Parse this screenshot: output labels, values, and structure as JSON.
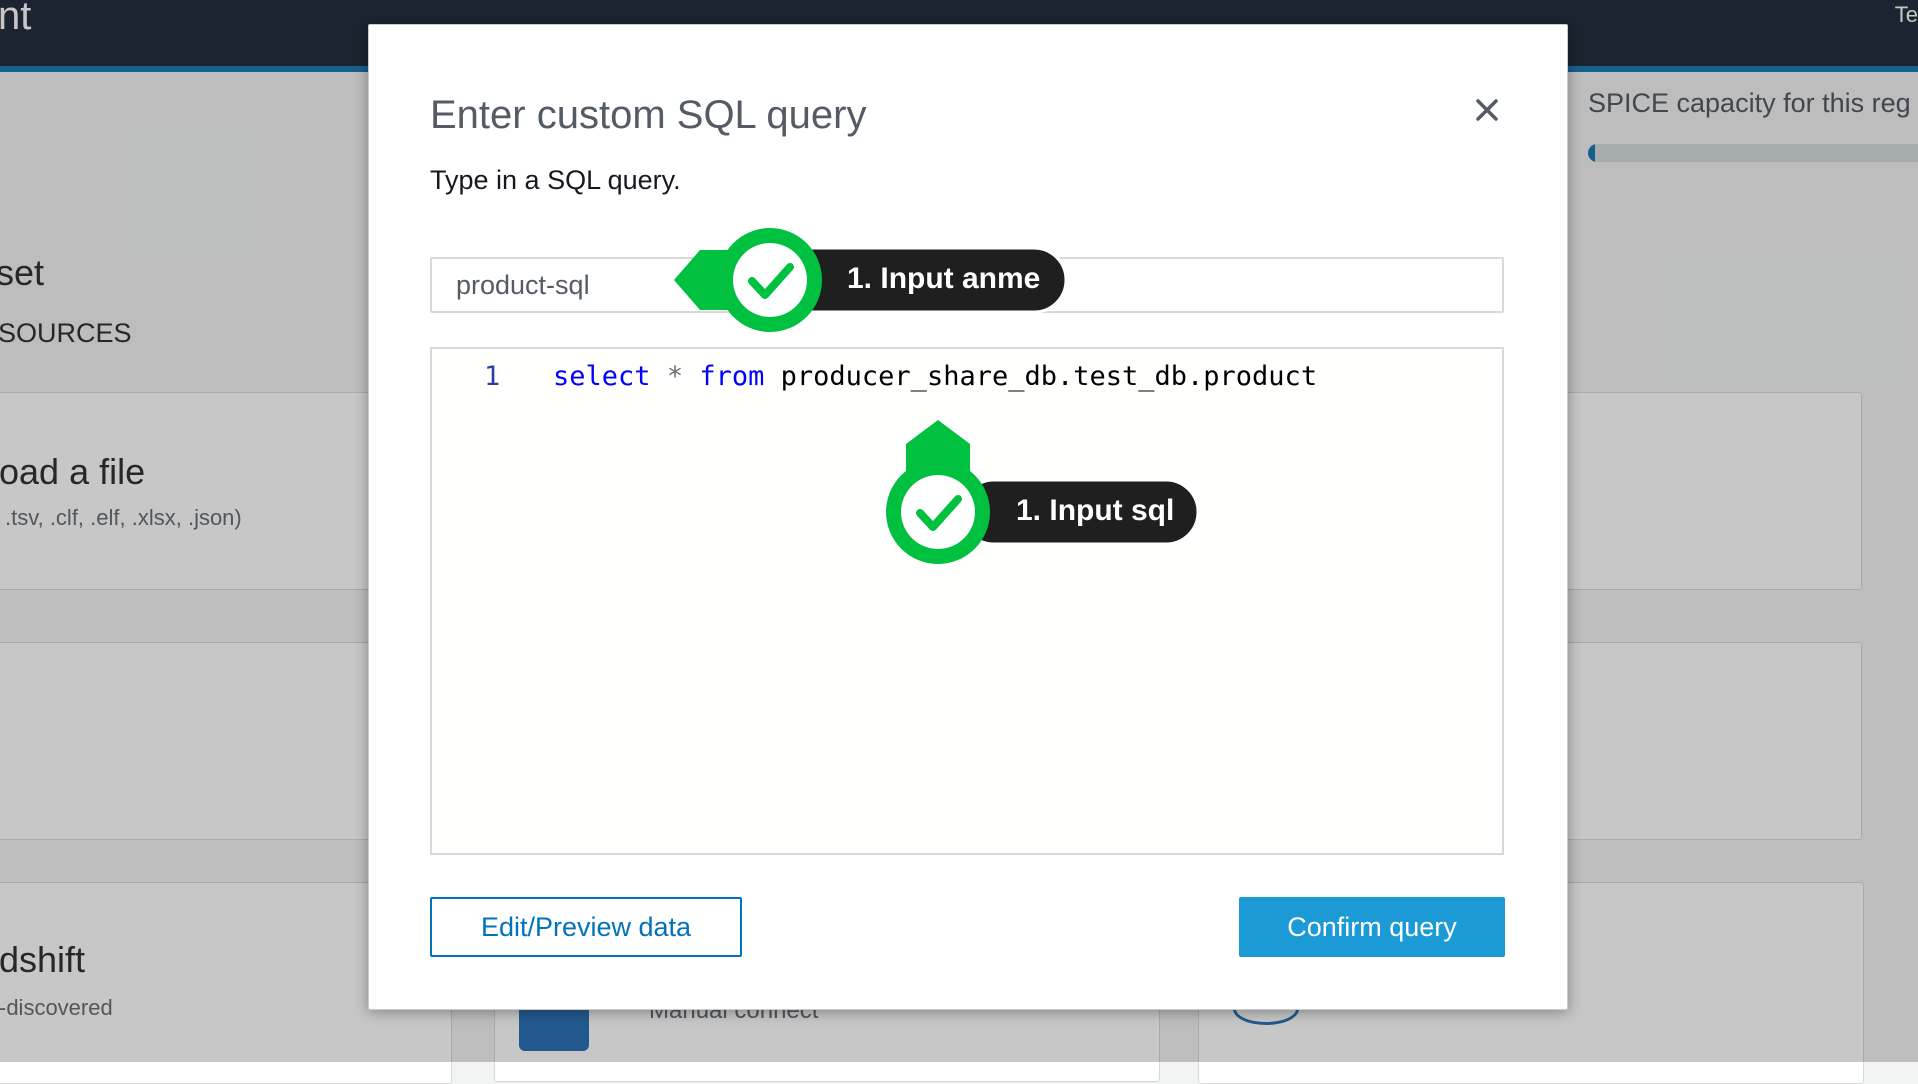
{
  "topbar": {
    "title_fragment": "nt",
    "right_fragment": "Te"
  },
  "background": {
    "section_title_fragment": "set",
    "section_sub_fragment": "SOURCES",
    "card1_title_fragment": "oad a file",
    "card1_sub_fragment": ".tsv, .clf, .elf, .xlsx, .json)",
    "card3_title_fragment": "dshift",
    "card3_sub_fragment": "-discovered",
    "bottom_card_text_fragment": "Manual connect",
    "spice_label": "SPICE capacity for this reg",
    "spice_fill_fraction": 0.02
  },
  "modal": {
    "title": "Enter custom SQL query",
    "subtitle": "Type in a SQL query.",
    "query_name_value": "product-sql",
    "sql": {
      "line_number": "1",
      "kw_select": "select",
      "op_star": "*",
      "kw_from": "from",
      "table": "producer_share_db.test_db.product"
    },
    "edit_preview_label": "Edit/Preview data",
    "confirm_label": "Confirm query"
  },
  "annotations": [
    {
      "label": "1. Input anme"
    },
    {
      "label": "1. Input sql"
    }
  ],
  "colors": {
    "callout_green": "#00c040",
    "callout_dark": "#1f1f1f",
    "primary_button": "#1b9ad6",
    "link_blue": "#0073bb",
    "sql_keyword": "#0000ff"
  }
}
